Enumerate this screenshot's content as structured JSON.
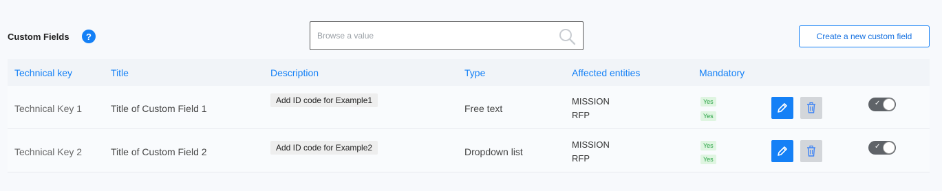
{
  "header": {
    "title": "Custom Fields",
    "help_icon": "?"
  },
  "search": {
    "placeholder": "Browse a value"
  },
  "actions": {
    "create_label": "Create a new custom field"
  },
  "columns": {
    "technical_key": "Technical key",
    "title": "Title",
    "description": "Description",
    "type": "Type",
    "affected_entities": "Affected entities",
    "mandatory": "Mandatory"
  },
  "rows": [
    {
      "technical_key": "Technical Key 1",
      "title": "Title of Custom Field 1",
      "description": "Add ID code for Example1",
      "type": "Free text",
      "entities": [
        "MISSION",
        "RFP"
      ],
      "mandatory": [
        "Yes",
        "Yes"
      ],
      "toggle_on": true
    },
    {
      "technical_key": "Technical Key 2",
      "title": "Title of Custom Field 2",
      "description": "Add ID code for Example2",
      "type": "Dropdown list",
      "entities": [
        "MISSION",
        "RFP"
      ],
      "mandatory": [
        "Yes",
        "Yes"
      ],
      "toggle_on": true
    }
  ],
  "colors": {
    "accent": "#1480f6",
    "badge_green": "#27a243",
    "toggle_dark": "#5f6368"
  },
  "icons": {
    "help": "help-icon",
    "search": "search-icon",
    "edit": "pencil-icon",
    "delete": "trash-icon",
    "check": "check-icon"
  }
}
